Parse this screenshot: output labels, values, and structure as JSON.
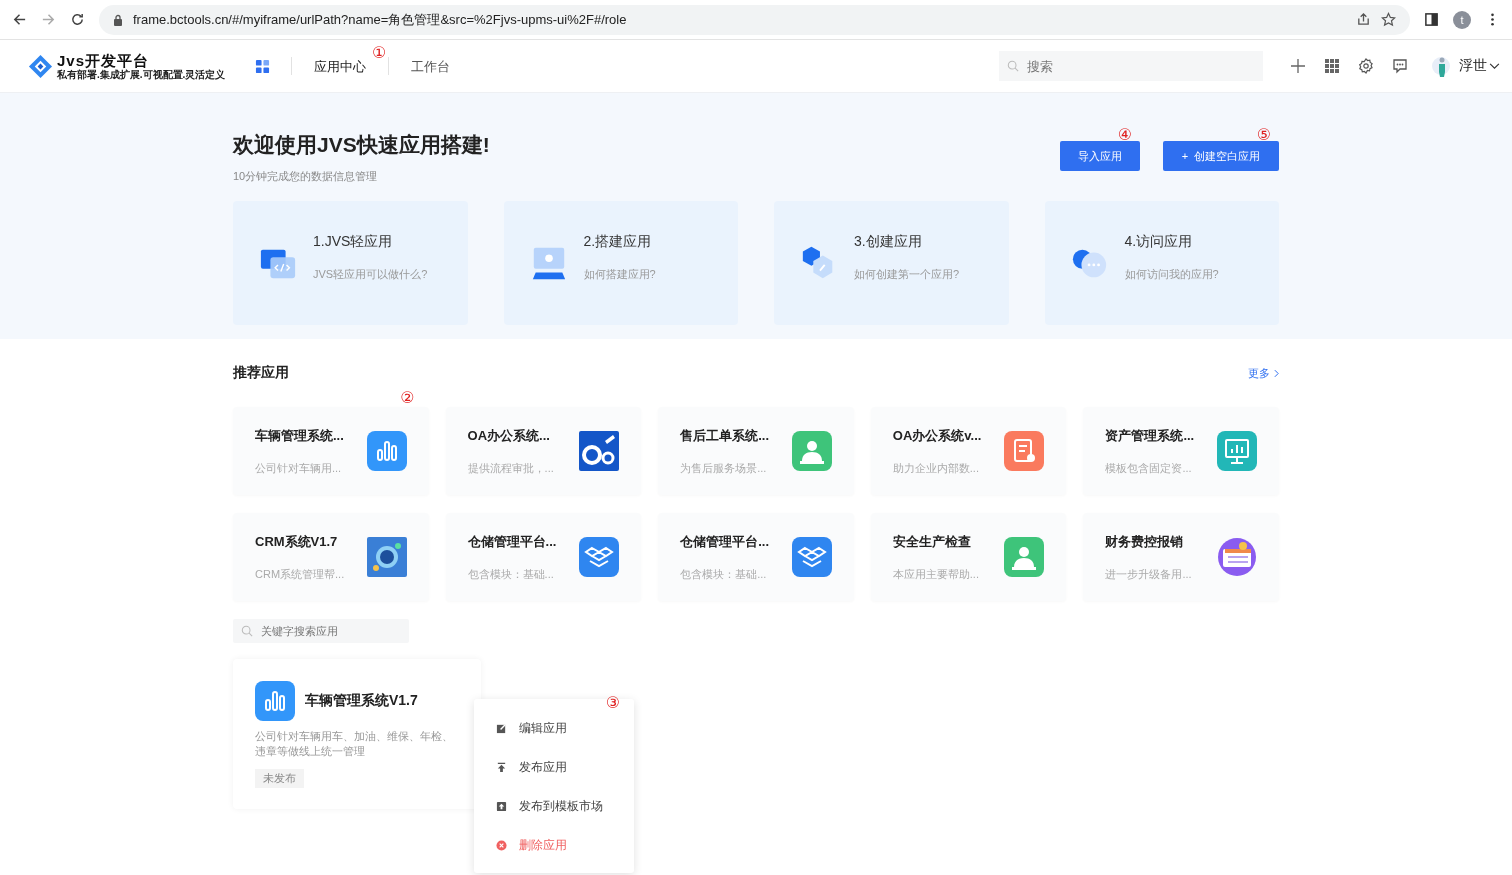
{
  "browser": {
    "url": "frame.bctools.cn/#/myiframe/urlPath?name=角色管理&src=%2Fjvs-upms-ui%2F#/role",
    "profile": "t"
  },
  "header": {
    "logo_title": "Jvs开发平台",
    "logo_subtitle": "私有部署.集成扩展.可视配置.灵活定义",
    "nav": [
      {
        "label": "应用中心",
        "selected": true,
        "marker": "①"
      },
      {
        "label": "工作台",
        "selected": false
      }
    ],
    "search": {
      "placeholder": "搜索"
    },
    "user": "浮世"
  },
  "hero": {
    "title": "欢迎使用JVS快速应用搭建!",
    "subtitle": "10分钟完成您的数据信息管理",
    "buttons": [
      {
        "label": "导入应用",
        "marker": "④",
        "kind": "plain"
      },
      {
        "label": "创建空白应用",
        "marker": "⑤",
        "kind": "add",
        "icon": "+"
      }
    ],
    "guides": [
      {
        "kind": "code",
        "title": "1.JVS轻应用",
        "desc": "JVS轻应用可以做什么?"
      },
      {
        "kind": "monitor",
        "title": "2.搭建应用",
        "desc": "如何搭建应用?"
      },
      {
        "kind": "hex",
        "title": "3.创建应用",
        "desc": "如何创建第一个应用?"
      },
      {
        "kind": "chat",
        "title": "4.访问应用",
        "desc": "如何访问我的应用?"
      }
    ]
  },
  "recommended": {
    "title": "推荐应用",
    "more": "更多",
    "marker": "②",
    "apps": [
      {
        "name": "车辆管理系统...",
        "desc": "公司针对车辆用...",
        "kind": "bars",
        "color": "#3296fa"
      },
      {
        "name": "OA办公系统...",
        "desc": "提供流程审批，...",
        "kind": "oa",
        "color": "#1456c8"
      },
      {
        "name": "售后工单系统...",
        "desc": "为售后服务场景...",
        "kind": "person",
        "color": "#3ec47a"
      },
      {
        "name": "OA办公系统v...",
        "desc": "助力企业内部数...",
        "kind": "doc",
        "color": "#fa7a5e"
      },
      {
        "name": "资产管理系统...",
        "desc": "模板包含固定资...",
        "kind": "monitor",
        "color": "#22b7b7"
      },
      {
        "name": "CRM系统V1.7",
        "desc": "CRM系统管理帮...",
        "kind": "crm",
        "color": "#3a7fd6"
      },
      {
        "name": "仓储管理平台...",
        "desc": "包含模块：基础...",
        "kind": "box",
        "color": "#2f86f0"
      },
      {
        "name": "仓储管理平台...",
        "desc": "包含模块：基础...",
        "kind": "box",
        "color": "#2f86f0"
      },
      {
        "name": "安全生产检查",
        "desc": "本应用主要帮助...",
        "kind": "person",
        "color": "#3ec47a"
      },
      {
        "name": "财务费控报销",
        "desc": "进一步升级备用...",
        "kind": "finance",
        "color": "#8a5cf0"
      }
    ]
  },
  "my_apps": {
    "search": {
      "placeholder": "关键字搜索应用"
    },
    "apps": [
      {
        "name": "车辆管理系统V1.7",
        "desc": "公司针对车辆用车、加油、维保、年检、违章等做线上统一管理",
        "status": "未发布",
        "kind": "bars",
        "color": "#3296fa"
      }
    ]
  },
  "context_menu": {
    "marker": "③",
    "items": [
      {
        "kind": "edit",
        "label": "编辑应用",
        "danger": false
      },
      {
        "kind": "publish",
        "label": "发布应用",
        "danger": false
      },
      {
        "kind": "market",
        "label": "发布到模板市场",
        "danger": false
      },
      {
        "kind": "delete",
        "label": "删除应用",
        "danger": true
      }
    ]
  }
}
